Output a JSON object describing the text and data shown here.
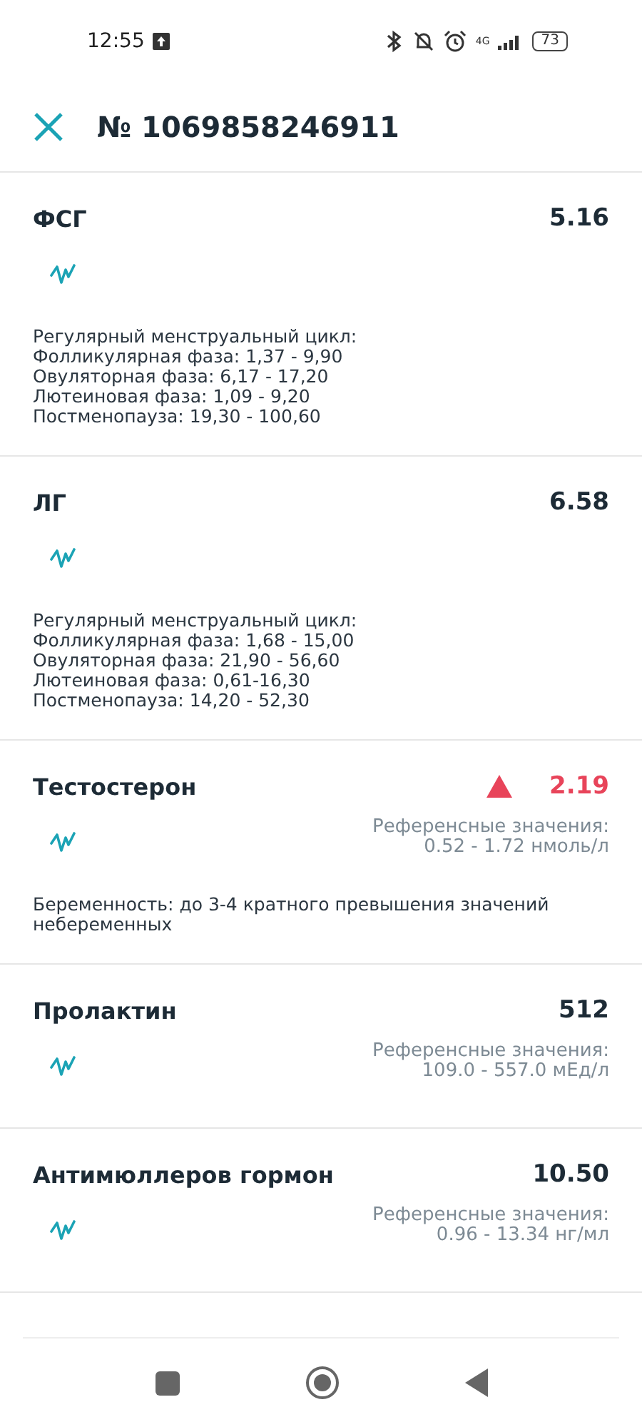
{
  "status_bar": {
    "time": "12:55",
    "network": "4G",
    "battery": "73"
  },
  "header": {
    "title": "№ 1069858246911"
  },
  "results": [
    {
      "name": "ФСГ",
      "value": "5.16",
      "above_range": false,
      "note": "Регулярный менструальный цикл:\nФолликулярная фаза: 1,37 - 9,90\nОвуляторная фаза: 6,17 - 17,20\nЛютеиновая фаза: 1,09 - 9,20\nПостменопауза: 19,30 - 100,60"
    },
    {
      "name": "ЛГ",
      "value": "6.58",
      "above_range": false,
      "note": "Регулярный менструальный цикл:\nФолликулярная фаза: 1,68 - 15,00\nОвуляторная фаза: 21,90 - 56,60\nЛютеиновая фаза: 0,61-16,30\nПостменопауза: 14,20 - 52,30"
    },
    {
      "name": "Тестостерон",
      "value": "2.19",
      "above_range": true,
      "reference": "Референсные значения:\n0.52 - 1.72 нмоль/л",
      "note": "Беременность: до 3-4 кратного превышения значений небеременных"
    },
    {
      "name": "Пролактин",
      "value": "512",
      "above_range": false,
      "reference": "Референсные значения:\n109.0 - 557.0 мЕд/л"
    },
    {
      "name": "Антимюллеров гормон",
      "value": "10.50",
      "above_range": false,
      "reference": "Референсные значения:\n0.96 - 13.34 нг/мл"
    }
  ]
}
